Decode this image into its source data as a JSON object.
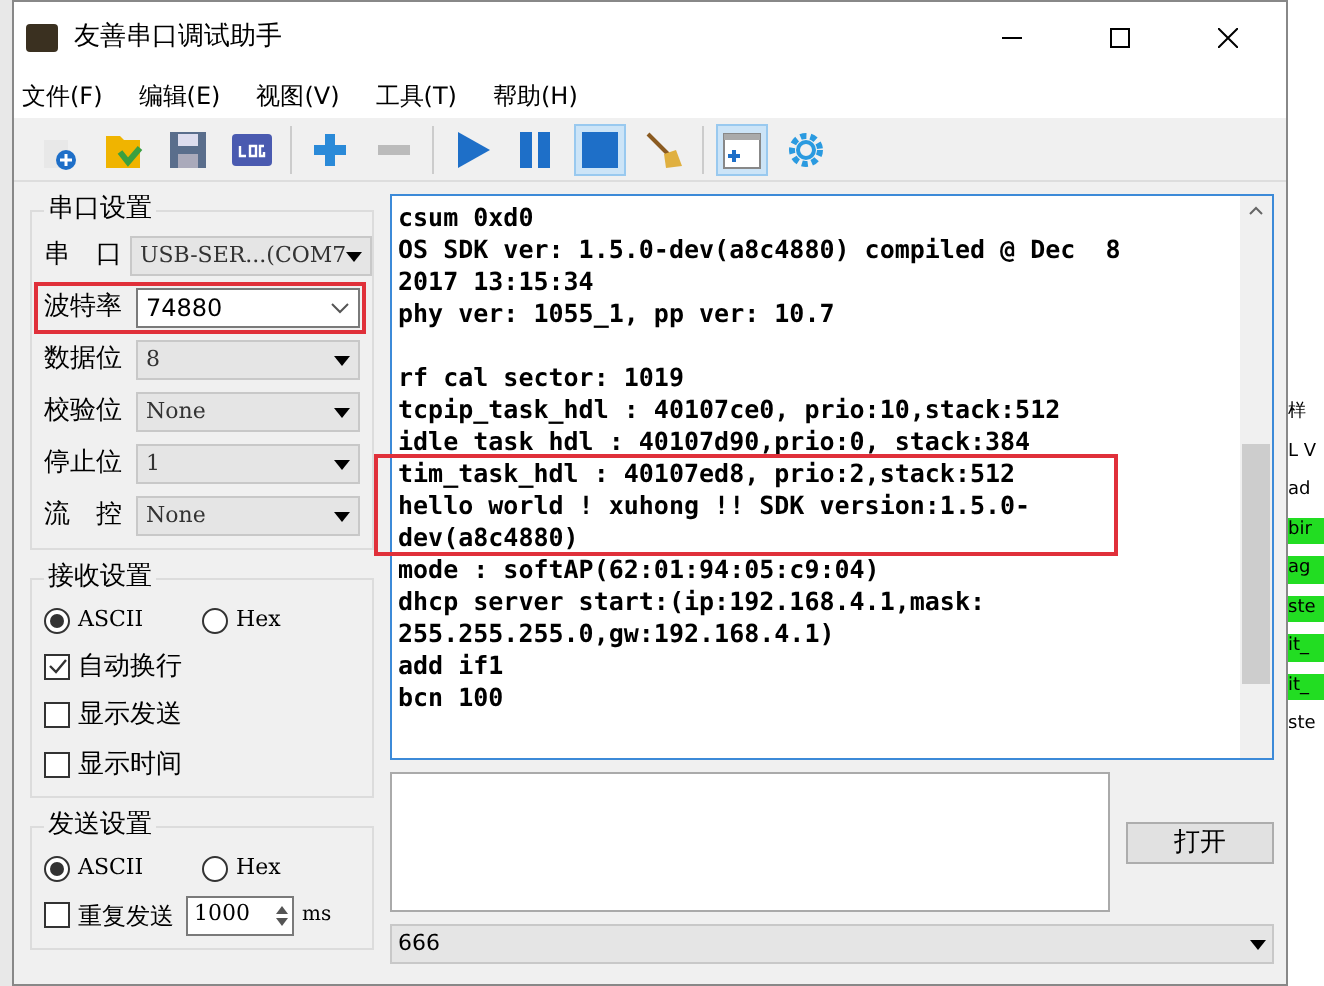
{
  "window": {
    "title": "友善串口调试助手"
  },
  "menu": [
    "文件(F)",
    "编辑(E)",
    "视图(V)",
    "工具(T)",
    "帮助(H)"
  ],
  "serial_settings": {
    "title": "串口设置",
    "fields": [
      {
        "label": "串　口",
        "value": "USB-SER...(COM7",
        "disabled": true
      },
      {
        "label": "波特率",
        "value": "74880",
        "disabled": false,
        "highlighted": true
      },
      {
        "label": "数据位",
        "value": "8",
        "disabled": true
      },
      {
        "label": "校验位",
        "value": "None",
        "disabled": true
      },
      {
        "label": "停止位",
        "value": "1",
        "disabled": true
      },
      {
        "label": "流　控",
        "value": "None",
        "disabled": true
      }
    ]
  },
  "receive_settings": {
    "title": "接收设置",
    "modes": [
      {
        "label": "ASCII",
        "selected": true
      },
      {
        "label": "Hex",
        "selected": false
      }
    ],
    "options": [
      {
        "label": "自动换行",
        "checked": true
      },
      {
        "label": "显示发送",
        "checked": false
      },
      {
        "label": "显示时间",
        "checked": false
      }
    ]
  },
  "send_settings": {
    "title": "发送设置",
    "modes": [
      {
        "label": "ASCII",
        "selected": true
      },
      {
        "label": "Hex",
        "selected": false
      }
    ],
    "repeat": {
      "label": "重复发送",
      "checked": false,
      "interval": "1000",
      "unit": "ms"
    }
  },
  "log": [
    {
      "kind": "text",
      "text": "csum 0xd0"
    },
    {
      "kind": "text",
      "text": "OS SDK ver: 1.5.0-dev(a8c4880) compiled @ Dec  8"
    },
    {
      "kind": "text",
      "text": "2017 13:15:34"
    },
    {
      "kind": "text",
      "text": "phy ver: 1055_1, pp ver: 10.7"
    },
    {
      "kind": "blank"
    },
    {
      "kind": "text",
      "text": "rf cal sector: 1019"
    },
    {
      "kind": "text",
      "text": "tcpip_task_hdl : 40107ce0, prio:10,stack:512"
    },
    {
      "kind": "text",
      "text": "idle task hdl : 40107d90,prio:0, stack:384"
    },
    {
      "kind": "text",
      "text": "tim_task_hdl : 40107ed8, prio:2,stack:512",
      "highlighted": true
    },
    {
      "kind": "text",
      "text": "hello world ! xuhong !! SDK version:1.5.0-",
      "highlighted": true
    },
    {
      "kind": "text",
      "text": "dev(a8c4880)",
      "highlighted": true
    },
    {
      "kind": "text",
      "text": "mode : softAP(62:01:94:05:c9:04)"
    },
    {
      "kind": "text",
      "text": "dhcp server start:(ip:192.168.4.1,mask:"
    },
    {
      "kind": "text",
      "text": "255.255.255.0,gw:192.168.4.1)"
    },
    {
      "kind": "text",
      "text": "add if1"
    },
    {
      "kind": "text",
      "text": "bcn 100"
    }
  ],
  "open_button": "打开",
  "history_combo": {
    "value": "666"
  },
  "background_window": [
    "样",
    "L V",
    "ad",
    "bir",
    "ag",
    "ste",
    "it_",
    "it_",
    "ste"
  ]
}
